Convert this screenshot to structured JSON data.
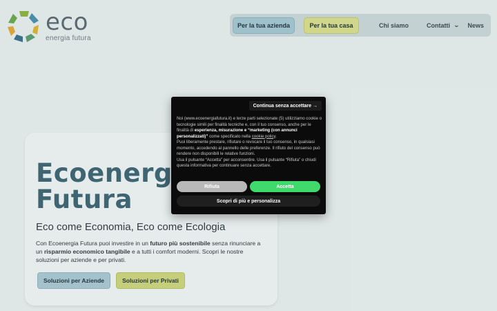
{
  "logo": {
    "word": "eco",
    "tagline": "energia futura"
  },
  "nav": {
    "btn_aziende": "Per la tua azienda",
    "btn_casa": "Per la tua casa",
    "link_chi_siamo": "Chi siamo",
    "link_contatti": "Contatti",
    "link_news": "News"
  },
  "hero": {
    "title": "Ecoenergia Futura",
    "subtitle": "Eco come Economia, Eco come Ecologia",
    "body": {
      "p1": "Con Ecoenergia Futura puoi investire in un ",
      "b1": "futuro più sostenibile",
      "p2": " senza rinunciare a un ",
      "b2": "risparmio economico tangibile",
      "p3": " e a tutti i comfort moderni. Scopri le nostre soluzioni per aziende e per privati."
    },
    "btn_aziende": "Soluzioni per Aziende",
    "btn_privati": "Soluzioni per Privati"
  },
  "cookie": {
    "continue_label": "Continua senza accettare →",
    "t1": "Noi (www.ecoenergiafutura.it) e terze parti selezionate (5) utilizziamo cookie o tecnologie simili per finalità tecniche e, con il tuo consenso, anche per le finalità di ",
    "t1b": "esperienza, misurazione e “marketing (con annunci personalizzati)”",
    "t2": " come specificato nella ",
    "link": "cookie policy",
    "t3": ".",
    "t4": "Puoi liberamente prestare, rifiutare o revocare il tuo consenso, in qualsiasi momento, accedendo al pannello delle preferenze. Il rifiuto del consenso può rendere non disponibili le relative funzioni.",
    "t5": "Usa il pulsante “Accetta” per acconsentire. Usa il pulsante “Rifiuta” o chiudi questa informativa per continuare senza accettare.",
    "btn_rifiuta": "Rifiuta",
    "btn_accetta": "Accetta",
    "btn_more": "Scopri di più e personalizza"
  },
  "colors": {
    "accent_blue": "#a2c6d1",
    "accent_green": "#d6dc8c",
    "title_blue": "#3e6472",
    "accept_green": "#3fd96c"
  },
  "icons": {
    "logo": "eco-logo-ring-icon",
    "dropdown": "chevron-down-icon"
  }
}
